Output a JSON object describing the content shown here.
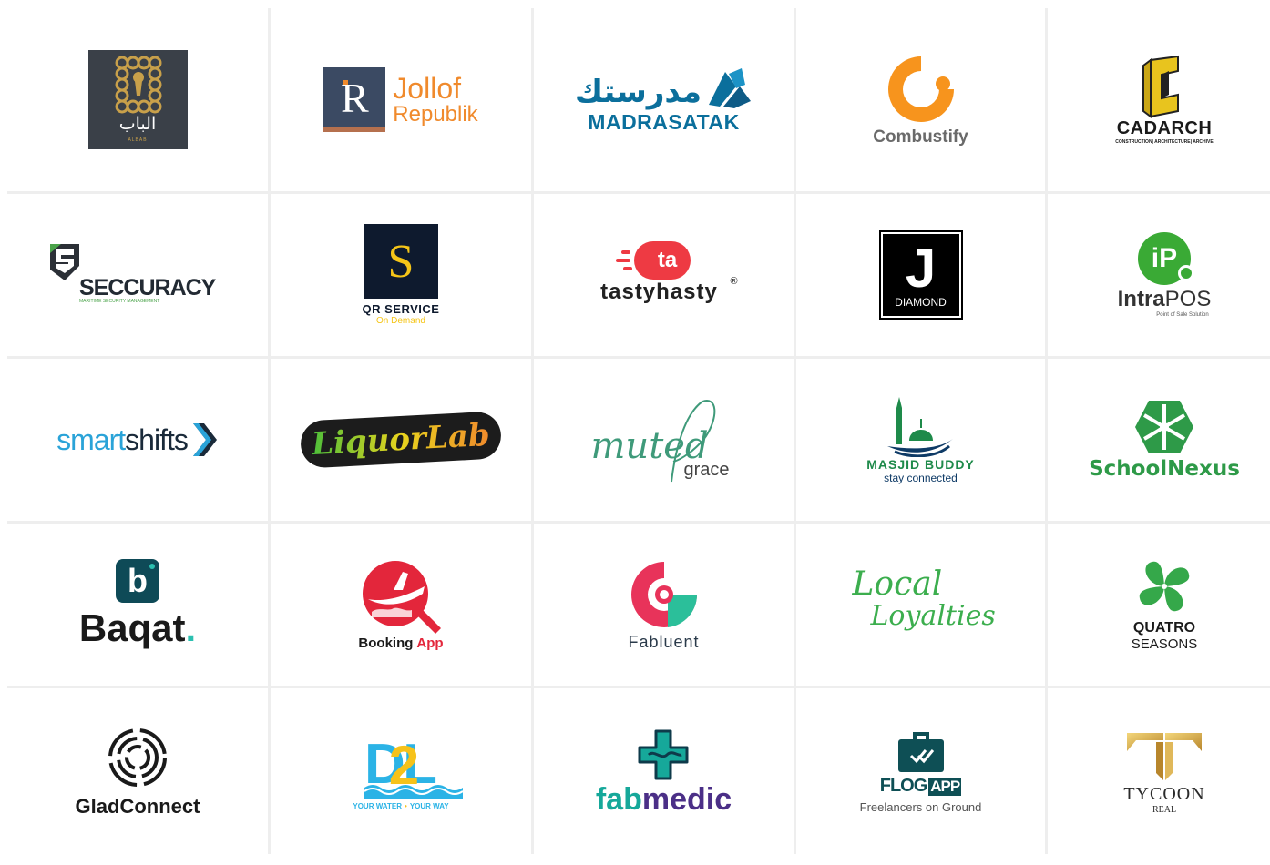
{
  "logos": {
    "albab": {
      "arabic": "الباب",
      "sub": "ALBAB"
    },
    "jollof": {
      "mark": "R",
      "line1": "Jollof",
      "line2": "Republik"
    },
    "madrasatak": {
      "arabic": "مدرستك",
      "name": "MADRASATAK"
    },
    "combustify": {
      "name": "Combustify"
    },
    "cadarch": {
      "name": "CADARCH",
      "tagline": "CONSTRUCTION| ARCHITECTURE| ARCHIVE"
    },
    "seccuracy": {
      "name": "SECCURACY",
      "tagline": "MARITIME SECURITY MANAGEMENT"
    },
    "qrservice": {
      "mark": "S",
      "name": "QR SERVICE",
      "tagline": "On Demand"
    },
    "tastyhasty": {
      "mark": "ta",
      "name": "tastyhasty",
      "reg": "®"
    },
    "diamond": {
      "mark": "J",
      "name": "DIAMOND"
    },
    "intrapos": {
      "mark": "iP",
      "name_a": "Intra",
      "name_b": "POS",
      "tagline": "Point of Sale Solution"
    },
    "smartshifts": {
      "name_a": "smart",
      "name_b": "shifts"
    },
    "liquorlab": {
      "name": "LiquorLab"
    },
    "mutedgrace": {
      "script": "muted",
      "name": "grace"
    },
    "masjidbuddy": {
      "name": "MASJID BUDDY",
      "tagline": "stay connected"
    },
    "schoolnexus": {
      "name": "SchoolNexus"
    },
    "baqat": {
      "mark": "b",
      "name": "Baqat",
      "dot": "."
    },
    "bookingapp": {
      "name_a": "Booking",
      "name_b": "App"
    },
    "fabluent": {
      "name": "Fabluent"
    },
    "localloyalties": {
      "line1": "Local",
      "line2": "Loyalties"
    },
    "quatro": {
      "line1": "QUATRO",
      "line2": "SEASONS"
    },
    "gladconnect": {
      "name": "GladConnect"
    },
    "d2l": {
      "mark_a": "D",
      "mark_b": "2",
      "mark_c": "L",
      "tag_a": "YOUR WATER",
      "tag_sep": "•",
      "tag_b": "YOUR WAY"
    },
    "fabmedic": {
      "name_a": "fab",
      "name_b": "medic"
    },
    "flogapp": {
      "name_a": "FLOG",
      "name_b": "APP",
      "tagline": "Freelancers on Ground"
    },
    "tycoon": {
      "name": "TYCOON",
      "tagline": "REAL"
    }
  },
  "icons": [
    "keyhole-icon",
    "book-icon",
    "flame-c-icon",
    "shield-icon",
    "gear-icon",
    "mosque-icon",
    "snowflake-icon",
    "plane-search-icon",
    "location-pin-icon",
    "clover-icon",
    "concentric-circles-icon",
    "medical-cross-icon",
    "briefcase-check-icon",
    "t-letter-icon"
  ],
  "colors": {
    "grid_line": "#eeeeee",
    "jollof_orange": "#f08a2c",
    "madrasatak_blue": "#0b6f9c",
    "combustify_orange": "#f7941d",
    "cadarch_yellow": "#e8c41e",
    "intrapos_green": "#3aaa35",
    "smartshifts_blue": "#2aa3d8",
    "masjid_green": "#1e8a4a",
    "schoolnexus_green": "#2e9a48",
    "baqat_teal": "#0e4a57",
    "booking_red": "#e3263b",
    "fabluent_pink": "#e8335a",
    "local_green": "#3cae4e",
    "quatro_green": "#35a84a",
    "d2l_blue": "#2bb3e6",
    "d2l_yellow": "#f6c21a",
    "fabmedic_teal": "#16a89a",
    "fabmedic_purple": "#4b2f87",
    "flog_teal": "#0e4f55",
    "tycoon_gold": "#c9a24a"
  }
}
